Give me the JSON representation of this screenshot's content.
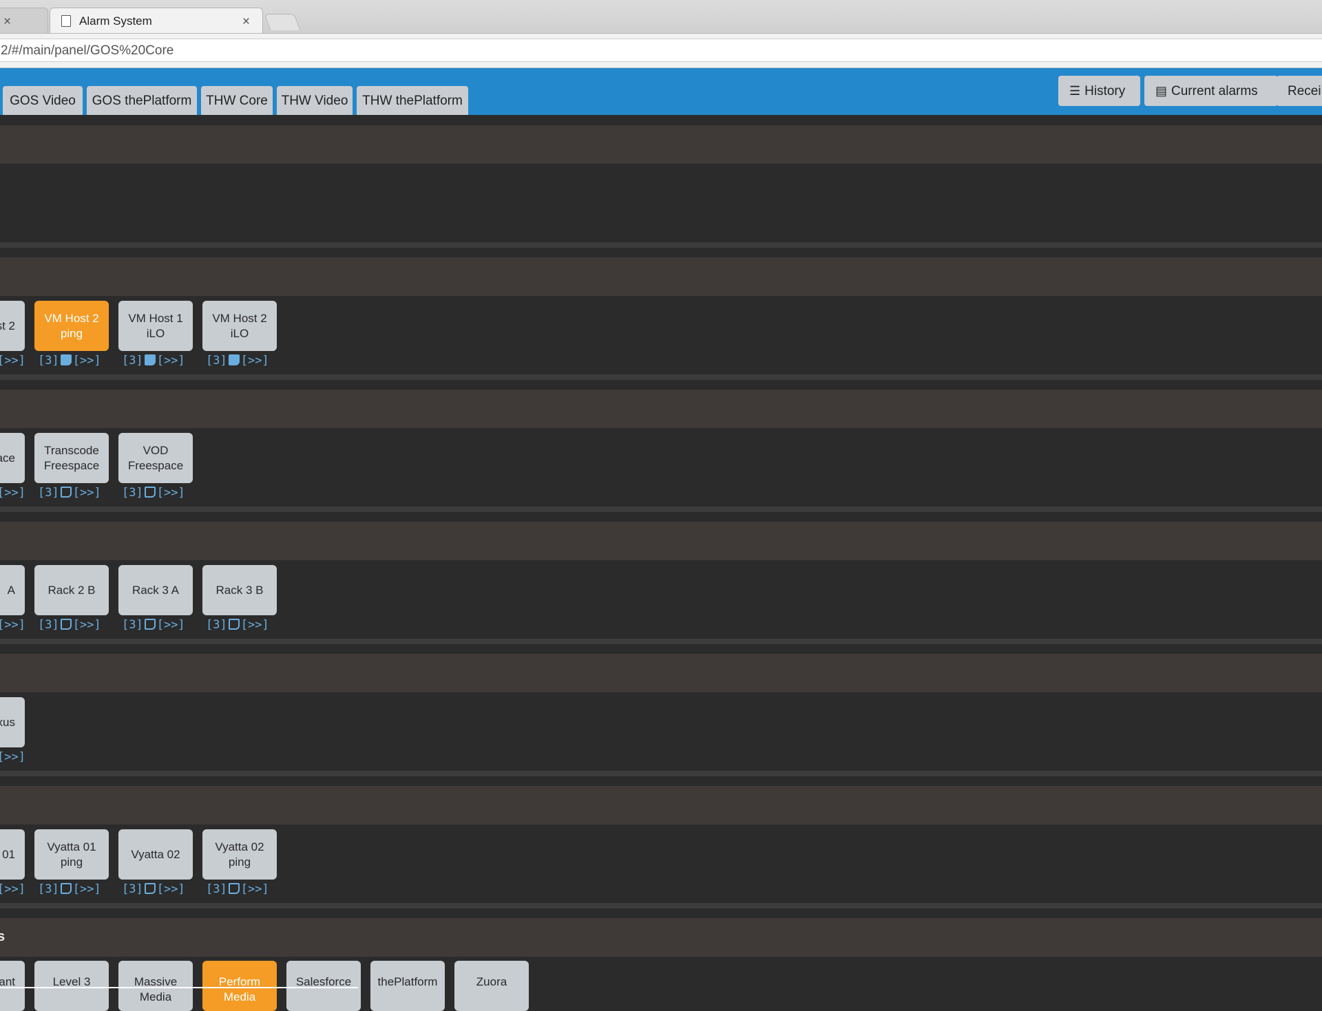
{
  "browser": {
    "active_tab_title": "Alarm System",
    "close_glyph": "×",
    "url": "2/#/main/panel/GOS%20Core"
  },
  "nav": {
    "tabs": [
      "GOS Video",
      "GOS thePlatform",
      "THW Core",
      "THW Video",
      "THW thePlatform"
    ],
    "history_label": "History",
    "current_alarms_label": "Current alarms",
    "receive_label": "Recei"
  },
  "colors": {
    "nav_blue": "#2488cc",
    "tile_default": "#c8cdd2",
    "tile_alarm": "#f49c25",
    "control_blue": "#6aaee0"
  },
  "controls_text": {
    "count": "[3]",
    "go": "[>>]",
    "go_partial": "[>>]"
  },
  "groups": [
    {
      "title": "",
      "tiles": []
    },
    {
      "title": "",
      "tiles": [
        {
          "label": "st 2",
          "state": "normal",
          "partial": true,
          "note_filled": true
        },
        {
          "label": "VM Host 2 ping",
          "state": "alarm",
          "note_filled": true
        },
        {
          "label": "VM Host 1 iLO",
          "state": "normal",
          "note_filled": true
        },
        {
          "label": "VM Host 2 iLO",
          "state": "normal",
          "note_filled": true
        }
      ]
    },
    {
      "title": "",
      "tiles": [
        {
          "label": "ace",
          "state": "normal",
          "partial": true,
          "note_filled": false
        },
        {
          "label": "Transcode Freespace",
          "state": "normal",
          "note_filled": false
        },
        {
          "label": "VOD Freespace",
          "state": "normal",
          "note_filled": false
        }
      ]
    },
    {
      "title": "",
      "tiles": [
        {
          "label": "A",
          "state": "normal",
          "partial": true,
          "note_filled": false
        },
        {
          "label": "Rack 2 B",
          "state": "normal",
          "note_filled": false
        },
        {
          "label": "Rack 3 A",
          "state": "normal",
          "note_filled": false
        },
        {
          "label": "Rack 3 B",
          "state": "normal",
          "note_filled": false
        }
      ]
    },
    {
      "title": "",
      "tiles": [
        {
          "label": "xus",
          "state": "normal",
          "partial": true,
          "note_filled": false
        }
      ]
    },
    {
      "title": "",
      "tiles": [
        {
          "label": "01",
          "state": "normal",
          "partial": true,
          "note_filled": false
        },
        {
          "label": "Vyatta 01 ping",
          "state": "normal",
          "note_filled": false
        },
        {
          "label": "Vyatta 02",
          "state": "normal",
          "note_filled": false
        },
        {
          "label": "Vyatta 02 ping",
          "state": "normal",
          "note_filled": false
        }
      ]
    },
    {
      "title": "s",
      "tiles": [
        {
          "label": "ant",
          "state": "normal",
          "partial": true
        },
        {
          "label": "Level 3",
          "state": "normal"
        },
        {
          "label": "Massive Media",
          "state": "normal"
        },
        {
          "label": "Perform Media",
          "state": "alarm"
        },
        {
          "label": "Salesforce",
          "state": "normal"
        },
        {
          "label": "thePlatform",
          "state": "normal"
        },
        {
          "label": "Zuora",
          "state": "normal"
        }
      ]
    }
  ]
}
